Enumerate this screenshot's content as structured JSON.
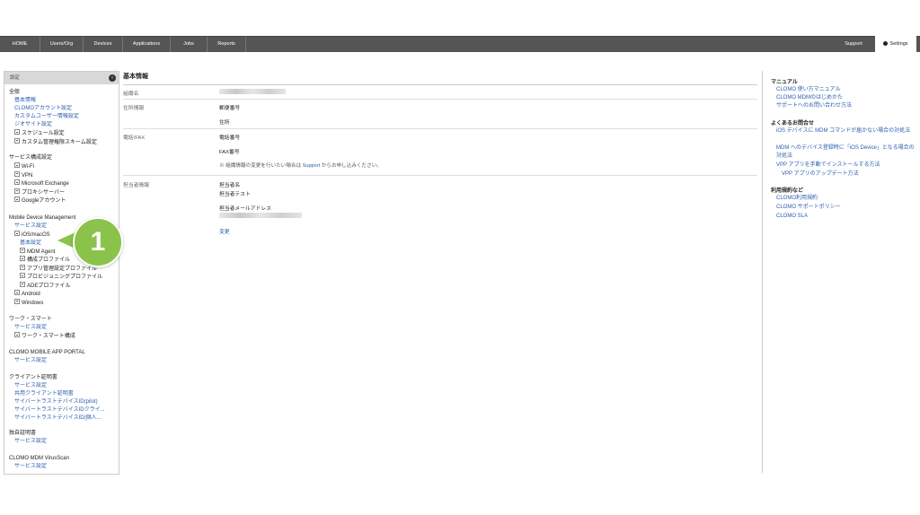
{
  "nav": {
    "items": [
      "HOME",
      "Users/Org",
      "Devices",
      "Applications",
      "Jobs",
      "Reports"
    ],
    "support": "Support",
    "settings": "Settings"
  },
  "sidebar": {
    "header": "設定",
    "general": {
      "title": "全般",
      "links": [
        "基本情報",
        "CLOMOアカウント設定",
        "カスタムユーザー情報設定",
        "ジオサイト設定"
      ],
      "expandables": [
        "スケジュール設定",
        "カスタム管理権限スキーム設定"
      ]
    },
    "service": {
      "title": "サービス構成設定",
      "items": [
        "Wi-Fi",
        "VPN",
        "Microsoft Exchange",
        "プロキシサーバー",
        "Googleアカウント"
      ]
    },
    "mdm": {
      "title": "Mobile Device Management",
      "service_link": "サービス設定",
      "ios": "iOS/macOS",
      "basic": "基本設定",
      "children": [
        "MDM Agent",
        "構成プロファイル",
        "アプリ管理設定プロファイル",
        "プロビジョニングプロファイル",
        "ADEプロファイル"
      ],
      "android": "Android",
      "windows": "Windows"
    },
    "work": {
      "title": "ワーク・スマート",
      "service_link": "サービス設定",
      "item": "ワーク・スマート構成"
    },
    "portal": {
      "title": "CLOMO MOBILE APP PORTAL",
      "service_link": "サービス設定"
    },
    "client": {
      "title": "クライアント証明書",
      "links": [
        "サービス設定",
        "共用クライアント証明書",
        "サイバートラストデバイスID(pilot)",
        "サイバートラストデバイスIDクライ...",
        "サイバートラストデバイスID(個人..."
      ]
    },
    "own": {
      "title": "独自証明書",
      "service_link": "サービス設定"
    },
    "virus": {
      "title": "CLOMO MDM VirusScan",
      "service_link": "サービス設定"
    }
  },
  "callout": {
    "number": "1"
  },
  "main": {
    "title": "基本情報",
    "org_label": "組織名",
    "address_label": "住所情報",
    "postal": "郵便番号",
    "address": "住所",
    "phone_label": "電話/FAX",
    "phone": "電話番号",
    "fax": "FAX番号",
    "note_prefix": "※ 組織情報の変更を行いたい場合は ",
    "note_link": "Support",
    "note_suffix": " からお申し込みください。",
    "contact_label": "担当者情報",
    "contact_name_label": "担当者名",
    "contact_name": "担当者テスト",
    "contact_email_label": "担当者メールアドレス",
    "change_link": "変更"
  },
  "right": {
    "manual_title": "マニュアル",
    "manual_links": [
      "CLOMO 使い方マニュアル",
      "CLOMO MDMのはじめかた",
      "サポートへのお問い合わせ方法"
    ],
    "faq_title": "よくあるお問合せ",
    "faq_links": [
      "iOS デバイスに MDM コマンドが届かない場合の対処法",
      "MDM へのデバイス登録時に「iOS Device」となる場合の対処法",
      "VPP アプリを手動でインストールする方法",
      "VPP アプリのアップデート方法"
    ],
    "terms_title": "利用規約など",
    "terms_links": [
      "CLOMO利用規約",
      "CLOMO サポートポリシー",
      "CLOMO SLA"
    ]
  }
}
